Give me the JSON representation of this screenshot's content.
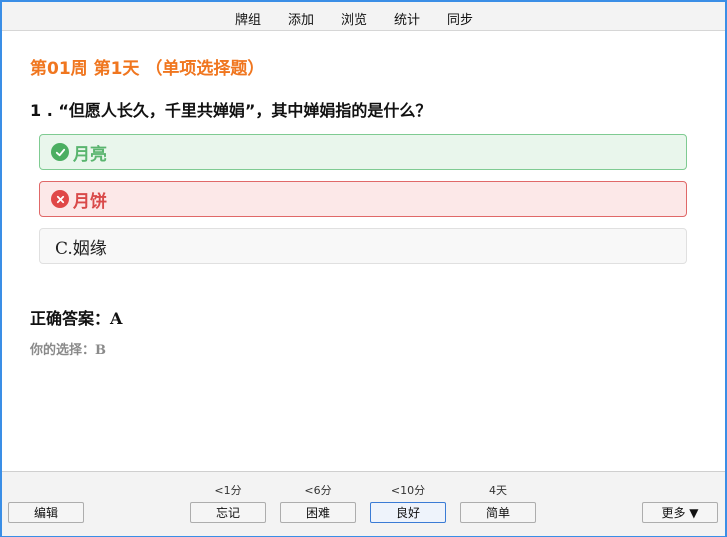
{
  "menu": [
    "牌组",
    "添加",
    "浏览",
    "统计",
    "同步"
  ],
  "section_title": "第01周 第1天 （单项选择题）",
  "question": "1 . “但愿人长久，千里共婵娟”，其中婵娟指的是什么？",
  "options": [
    {
      "text": "月亮",
      "state": "correct",
      "icon": "check-circle-icon"
    },
    {
      "text": "月饼",
      "state": "wrong",
      "icon": "x-circle-icon"
    },
    {
      "text": "C.姻缘",
      "state": "neutral"
    }
  ],
  "correct_answer": {
    "label": "正确答案：",
    "value": "A"
  },
  "your_choice": {
    "label": "你的选择：",
    "value": "B"
  },
  "bottom": {
    "edit": "编辑",
    "more": "更多 ▼",
    "ratings": [
      {
        "interval": "<1分",
        "label": "忘记"
      },
      {
        "interval": "<6分",
        "label": "困难"
      },
      {
        "interval": "<10分",
        "label": "良好"
      },
      {
        "interval": "4天",
        "label": "简单"
      }
    ]
  },
  "colors": {
    "frame": "#3a8ee6",
    "title": "#f0761f",
    "correct": "#4cae62",
    "wrong": "#e04848"
  }
}
